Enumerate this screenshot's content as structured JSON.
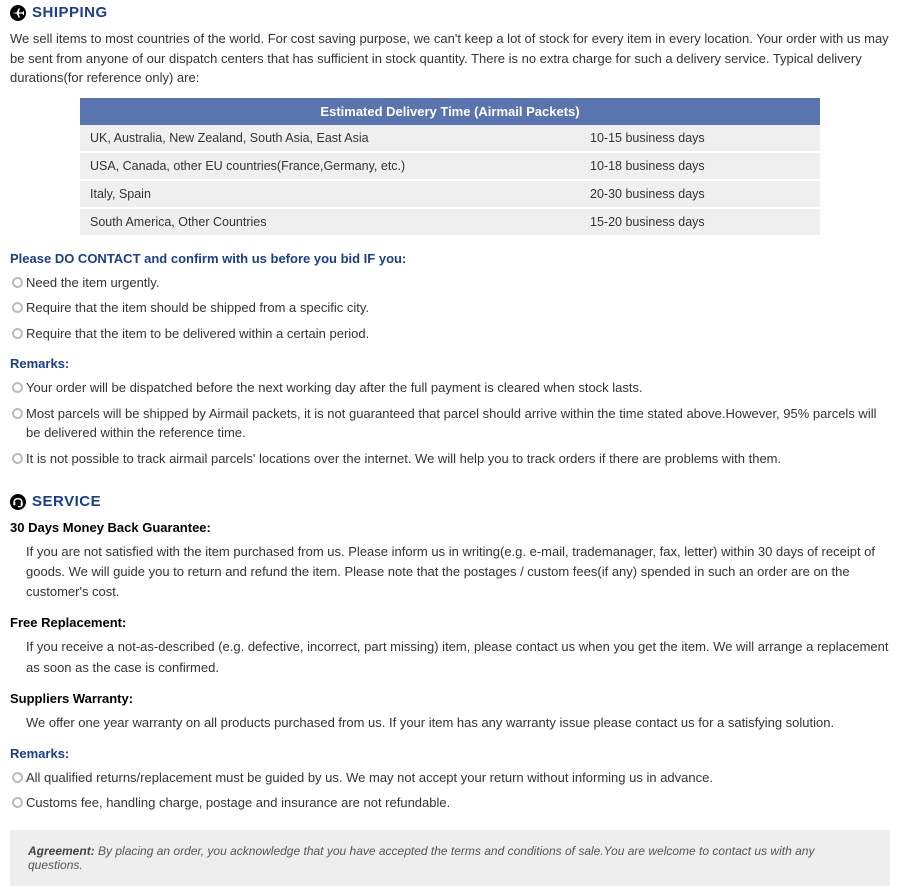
{
  "shipping": {
    "heading": "SHIPPING",
    "intro": "We sell items to most countries of the world. For cost saving purpose, we can't keep a lot of stock for every item in every location. Your order with us may be sent from anyone of our dispatch centers that has sufficient in stock quantity. There is no extra charge for such a delivery service. Typical delivery durations(for reference only) are:",
    "table_header": "Estimated Delivery Time (Airmail Packets)",
    "rows": [
      {
        "region": "UK, Australia, New Zealand, South Asia, East Asia",
        "time": "10-15 business days"
      },
      {
        "region": "USA, Canada, other EU countries(France,Germany, etc.)",
        "time": "10-18 business days"
      },
      {
        "region": "Italy, Spain",
        "time": "20-30 business days"
      },
      {
        "region": "South America, Other Countries",
        "time": "15-20 business days"
      }
    ],
    "contact_head": "Please DO CONTACT and confirm with us before you bid IF you:",
    "contact_items": [
      "Need the item urgently.",
      "Require that the item should be shipped from a specific city.",
      "Require that the item to be delivered within a certain period."
    ],
    "remarks_head": "Remarks:",
    "remarks_items": [
      "Your order will be dispatched before the next working day after the full payment is cleared when stock lasts.",
      "Most parcels will be shipped by Airmail packets, it is not guaranteed that parcel should arrive within the time stated above.However, 95% parcels will be delivered within the reference time.",
      "It is not possible to track airmail parcels' locations over the internet. We will help you to track orders if there are problems with them."
    ]
  },
  "service": {
    "heading": "SERVICE",
    "guarantee_head": "30 Days Money Back Guarantee:",
    "guarantee_text": "If you are not satisfied with the item purchased from us. Please inform us in writing(e.g. e-mail, trademanager, fax, letter) within 30 days of receipt of goods. We will guide you to return and refund the item. Please note that the postages / custom fees(if any) spended in such an order are on the customer's cost.",
    "replace_head": "Free Replacement:",
    "replace_text": "If you receive a not-as-described (e.g. defective, incorrect, part missing) item, please contact us when you get the item. We will arrange a replacement as soon as the case is confirmed.",
    "warranty_head": "Suppliers Warranty:",
    "warranty_text": "We offer one year warranty on all products purchased from us. If your item has any warranty issue please contact us for a satisfying solution.",
    "remarks_head": "Remarks:",
    "remarks_items": [
      "All qualified returns/replacement must be guided by us. We may not accept your return without informing us in advance.",
      "Customs fee, handling charge, postage and insurance are not refundable."
    ]
  },
  "agreement": {
    "label": "Agreement:",
    "text": " By placing an order, you acknowledge that you have accepted the terms and conditions of sale.You are welcome to contact us with any questions."
  }
}
